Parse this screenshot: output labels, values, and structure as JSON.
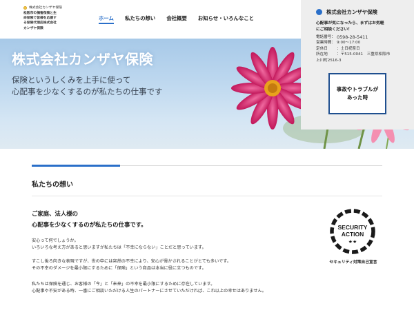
{
  "header": {
    "logo_name": "株式会社カンザヤ保険",
    "logo_desc": "松阪市の損害保険と生\n命保険で皆様を応援す\nる保険代理店株式会社\nカンザヤ保険"
  },
  "nav": {
    "items": [
      {
        "label": "ホーム",
        "active": true
      },
      {
        "label": "私たちの想い",
        "active": false
      },
      {
        "label": "会社概要",
        "active": false
      },
      {
        "label": "お知らせ・いろんなこと",
        "active": false
      }
    ]
  },
  "hero": {
    "title": "株式会社カンザヤ保険",
    "subtitle_line1": "保険というしくみを上手に使って",
    "subtitle_line2": "心配事を少なくするのが私たちの仕事です"
  },
  "info": {
    "company": "株式会社カンザヤ保険",
    "message": "心配事が気になったら、まずはお気軽\nにご相談ください！",
    "rows": [
      {
        "label": "電話番号：",
        "value": "0598-28-5411"
      },
      {
        "label": "営業時間：",
        "value": "9:00～17:00"
      },
      {
        "label": "定休日",
        "value": "：土日祝祭日"
      },
      {
        "label": "所在地",
        "value": "：〒515-0041　三重県松阪市"
      },
      {
        "label": "",
        "value": "上川町2516-3"
      }
    ],
    "trouble_button": "事故やトラブルが\nあった時"
  },
  "section": {
    "title": "私たちの想い",
    "lead": "ご家庭、法人様の\n心配事を少なくするのが私たちの仕事です。",
    "paragraphs": [
      "安心って何でしょうか。\nいろいろな考え方があると思いますが私たちは「不幸にならない」ことだと思っています。",
      "すこし後ろ向きな表現ですが、世の中には突然の不幸により、安心が脅かされることがとても多いです。\nその不幸のダメージを最小限にするために「保険」という商品は本当に役に立つものです。",
      "私たちは保険を通じ、お客様の「今」と「未来」の不幸を最小限にするために存在しています。\n心配事や不安がある時、一番にご相談いただける人生のパートナーにさせていただければ、これ以上の幸せはありません。"
    ],
    "badge_text_1": "SECURITY",
    "badge_text_2": "ACTION",
    "badge_stars": "★★",
    "badge_caption": "セキュリティ対策自己宣言"
  },
  "colors": {
    "accent": "#2a6fc9",
    "button_border": "#1f4f8f",
    "panel_bg": "#eeeeee"
  }
}
